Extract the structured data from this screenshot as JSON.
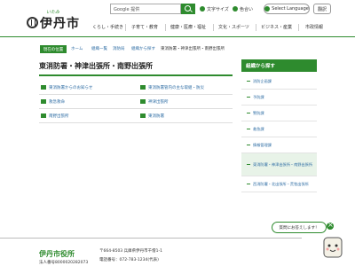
{
  "header": {
    "logo_kana": "いたみ",
    "logo_text": "伊丹市",
    "search_value": "Google 提供",
    "links": {
      "font_size": "文字サイズ",
      "color": "色合い"
    },
    "lang_label": "Select Language",
    "read_label": "翻訳",
    "nav": [
      "くらし・手続き",
      "子育て・教育",
      "健康・医療・福祉",
      "文化・スポーツ",
      "ビジネス・産業",
      "市政情報"
    ]
  },
  "breadcrumb": {
    "label": "現在の位置",
    "items": [
      "ホーム",
      "組織一覧",
      "消防局",
      "組織から探す",
      "東消防署・神津出張所・南野出張所"
    ]
  },
  "main": {
    "title": "東消防署・神津出張所・南野出張所",
    "links": [
      [
        "東消防署からのお知らせ",
        "東消防署管内の主な取組・防災"
      ],
      [
        "救急救命",
        "神津出張所"
      ],
      [
        "南野出張所",
        "東消防署"
      ]
    ]
  },
  "sidebar": {
    "heading": "組織から探す",
    "items": [
      "消防企画課",
      "予防課",
      "警防課",
      "救急課",
      "情報管理課",
      "東消防署・神津出張所・南野出張所",
      "西消防署・北出張所・荒牧出張所"
    ]
  },
  "chat": {
    "label": "質問にお答えします！"
  },
  "footer": {
    "name": "伊丹市役所",
    "corp_no": "法人番号8000020282073",
    "address": "〒664-8503 兵庫県伊丹市千僧1-1",
    "tel": "電話番号：072-783-1234(代表)"
  },
  "colors": {
    "accent": "#2e8b2e",
    "link": "#2e6da4"
  }
}
